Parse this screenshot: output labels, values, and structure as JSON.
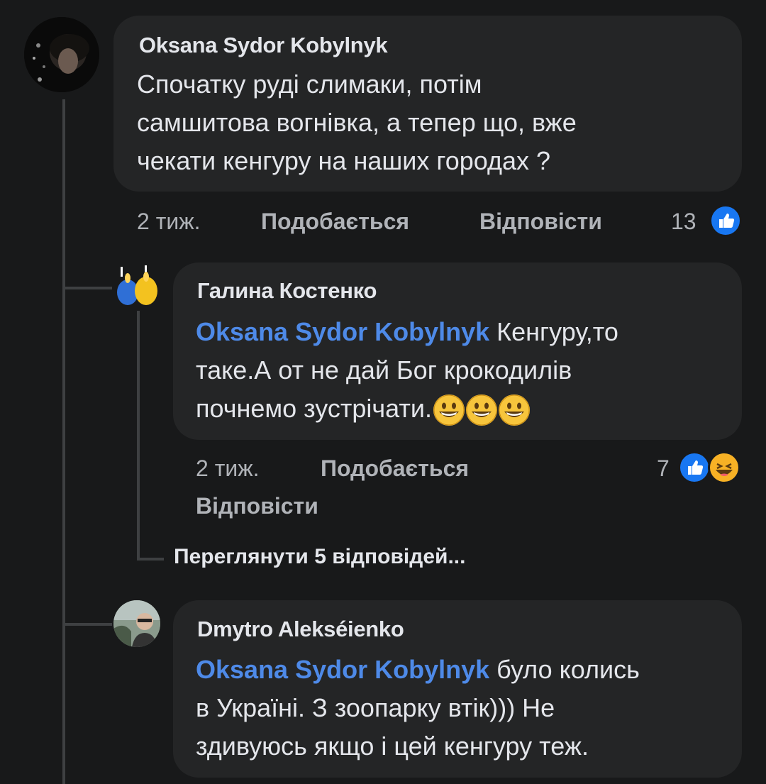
{
  "comments": [
    {
      "author": "Oksana Sydor Kobylnyk",
      "text_line1": "Спочатку руді слимаки, потім",
      "text_line2": "самшитова вогнівка, а  тепер що, вже",
      "text_line3": "чекати кенгуру на наших городах ?",
      "time": "2 тиж.",
      "like_label": "Подобається",
      "reply_label": "Відповісти",
      "reaction_count": "13",
      "reactions": [
        "like-icon"
      ]
    }
  ],
  "replies": [
    {
      "author": "Галина Костенко",
      "mention": "Oksana Sydor Kobylnyk",
      "text_line1": " Кенгуру,то",
      "text_line2": "таке.А от не дай Бог крокодилів",
      "text_line3": "почнемо зустрічати.",
      "emojis": [
        "grinning-face",
        "grinning-face",
        "grinning-face"
      ],
      "time": "2 тиж.",
      "like_label": "Подобається",
      "reply_label": "Відповісти",
      "reaction_count": "7",
      "reactions": [
        "like-icon",
        "haha-icon"
      ]
    },
    {
      "author": "Dmytro Alekséienko",
      "mention": "Oksana Sydor Kobylnyk",
      "text_line1": " було колись",
      "text_line2": "в Україні. З зоопарку втік))) Не",
      "text_line3": "здивуюсь якщо і цей кенгуру теж."
    }
  ],
  "view_replies_label": "Переглянути 5 відповідей...",
  "colors": {
    "background": "#18191a",
    "bubble": "#242526",
    "mention": "#4e8ae8",
    "like_blue": "#1877f2",
    "haha_yellow": "#f7b125"
  }
}
